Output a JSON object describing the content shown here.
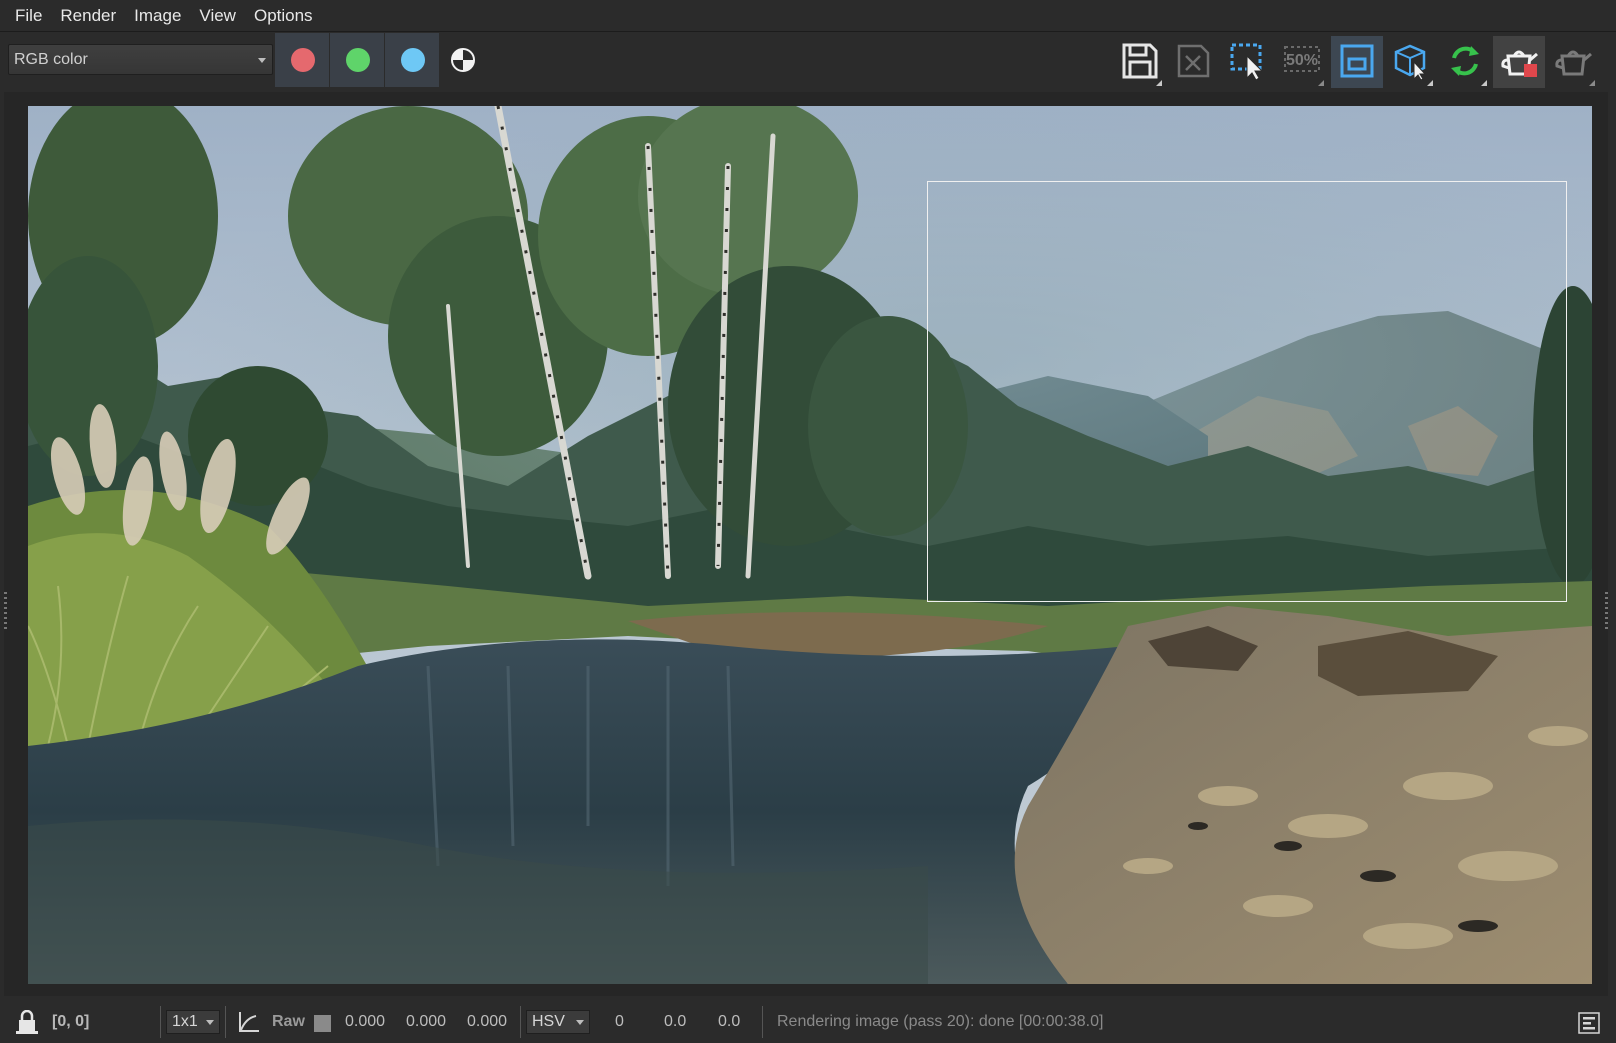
{
  "menu": [
    "File",
    "Render",
    "Image",
    "View",
    "Options"
  ],
  "toolbar": {
    "channel_select": "RGB color",
    "channels": [
      {
        "name": "red-channel",
        "color": "#e5696e"
      },
      {
        "name": "green-channel",
        "color": "#5fd46a"
      },
      {
        "name": "blue-channel",
        "color": "#6ec8f5"
      }
    ],
    "zoom_badge": "50%",
    "icons": [
      "save-icon",
      "clear-image-icon",
      "select-region-icon",
      "zoom-50-icon",
      "render-region-icon",
      "pick-object-icon",
      "auto-refresh-icon",
      "render-teapot-icon",
      "render-teapot-disabled-icon"
    ]
  },
  "status": {
    "coords": "[0, 0]",
    "sample_size": "1x1",
    "mode": "Raw",
    "rgb": [
      "0.000",
      "0.000",
      "0.000"
    ],
    "color_space": "HSV",
    "hsv": [
      "0",
      "0.0",
      "0.0"
    ],
    "message": "Rendering image (pass 20): done [00:00:38.0]"
  }
}
